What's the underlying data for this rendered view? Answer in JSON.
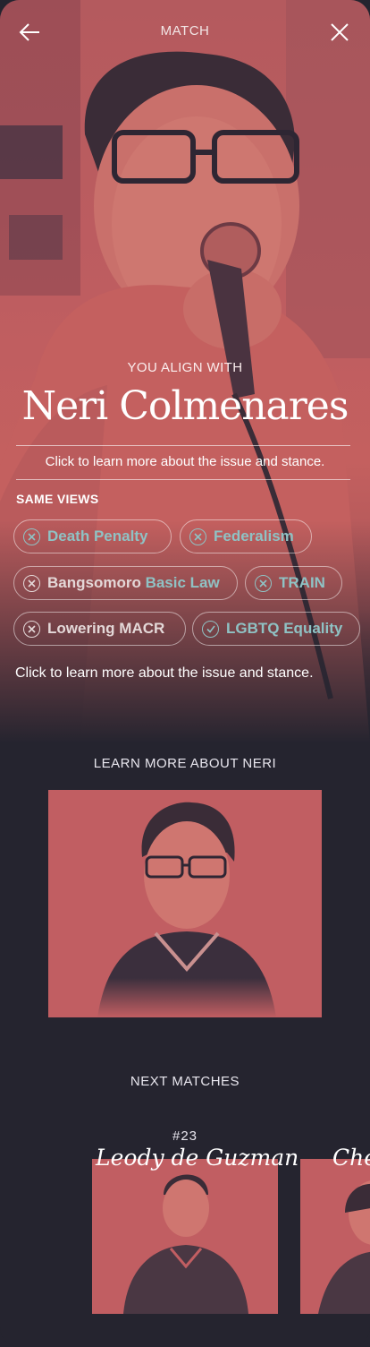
{
  "header": {
    "title": "MATCH",
    "back_icon": "arrow-left-icon",
    "close_icon": "close-icon"
  },
  "hero": {
    "align_label": "YOU ALIGN WITH",
    "candidate_name": "Neri Colmenares",
    "learn_text": "Click to learn more about the issue and stance.",
    "same_views_label": "SAME VIEWS",
    "learn_text_bottom": "Click to learn more about the issue and stance.",
    "accent_color": "#8fc2c4",
    "overlay_color": "#c15e62"
  },
  "issues": [
    {
      "label": "Death Penalty",
      "icon": "x-circle-icon",
      "style": "teal"
    },
    {
      "label": "Federalism",
      "icon": "x-circle-icon",
      "style": "teal"
    },
    {
      "label_part1": "Bangsomoro ",
      "label_part2": "Basic Law",
      "icon": "x-circle-icon",
      "style": "mix"
    },
    {
      "label": "TRAIN",
      "icon": "x-circle-icon",
      "style": "teal"
    },
    {
      "label": "Lowering MACR",
      "icon": "x-circle-icon",
      "style": "gray"
    },
    {
      "label": "LGBTQ Equality",
      "icon": "check-circle-icon",
      "style": "teal"
    }
  ],
  "learn_more": {
    "title": "LEARN MORE ABOUT NERI"
  },
  "next_matches": {
    "title": "NEXT MATCHES",
    "items": [
      {
        "rank": "#23",
        "name": "Leody de Guzman"
      },
      {
        "rank": "",
        "name": "Che"
      }
    ]
  },
  "background_color": "#25242f"
}
